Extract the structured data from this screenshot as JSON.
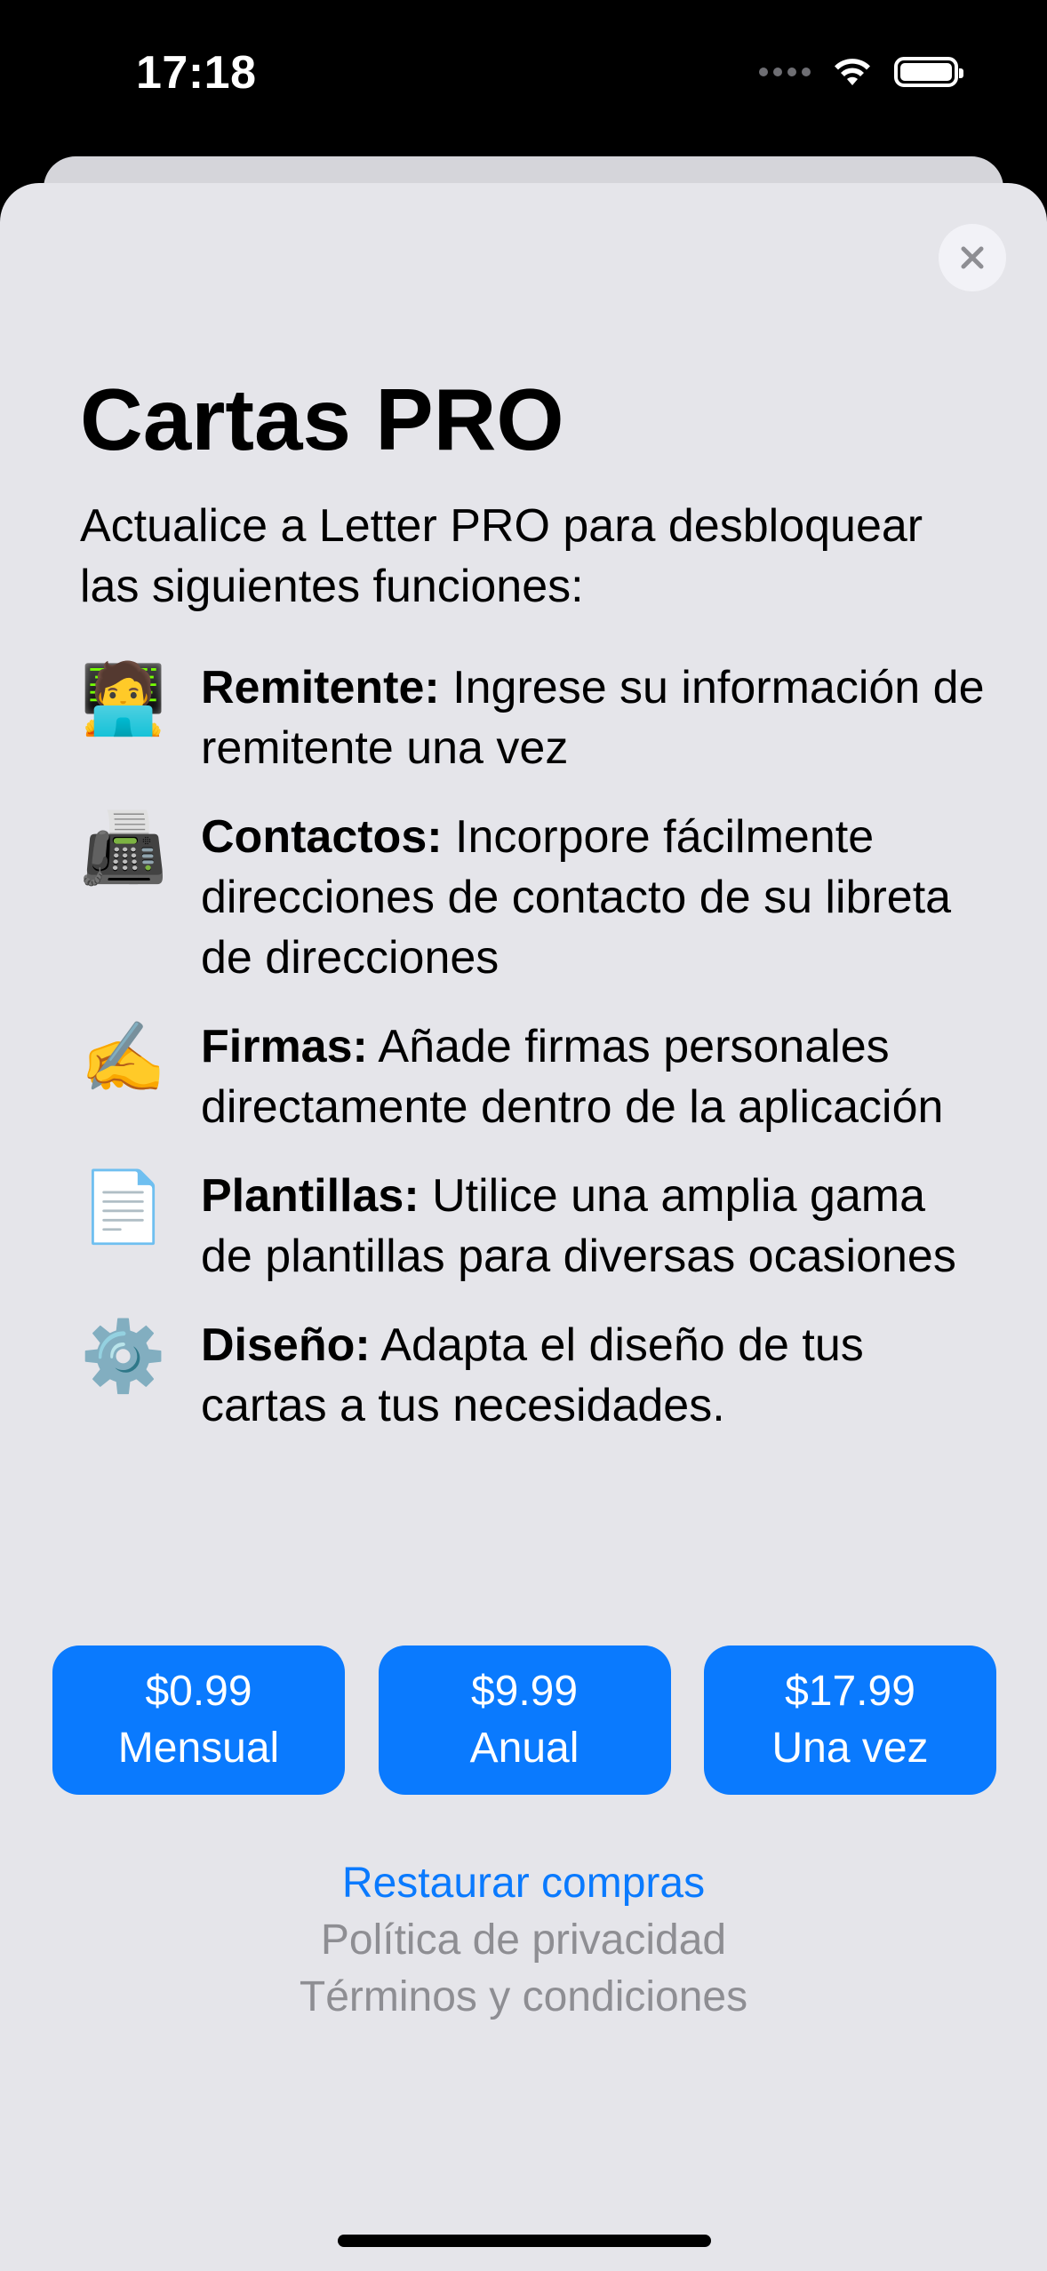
{
  "status_bar": {
    "time": "17:18",
    "icons": [
      "cellular-dots-icon",
      "wifi-icon",
      "battery-icon"
    ]
  },
  "sheet": {
    "title": "Cartas PRO",
    "subtitle": "Actualice a Letter PRO para desbloquear las siguientes funciones:",
    "close_icon": "close-icon"
  },
  "features": [
    {
      "icon": "🧑‍💻",
      "title": "Remitente:",
      "description": " Ingrese su información de remitente una vez"
    },
    {
      "icon": "📠",
      "title": "Contactos:",
      "description": " Incorpore fácilmente direcciones de contacto de su libreta de direcciones"
    },
    {
      "icon": "✍️",
      "title": "Firmas:",
      "description": " Añade firmas personales directamente dentro de la aplicación"
    },
    {
      "icon": "📄",
      "title": "Plantillas:",
      "description": " Utilice una amplia gama de plantillas para diversas ocasiones"
    },
    {
      "icon": "⚙️",
      "title": "Diseño:",
      "description": " Adapta el diseño de tus cartas a tus necesidades."
    }
  ],
  "plans": [
    {
      "price": "$0.99",
      "period": "Mensual"
    },
    {
      "price": "$9.99",
      "period": "Anual"
    },
    {
      "price": "$17.99",
      "period": "Una vez"
    }
  ],
  "links": {
    "restore": "Restaurar compras",
    "privacy": "Política de privacidad",
    "terms": "Términos y condiciones"
  },
  "colors": {
    "accent": "#0a7afe",
    "sheet_background": "#e5e5ea",
    "muted_text": "#8e8e93"
  }
}
